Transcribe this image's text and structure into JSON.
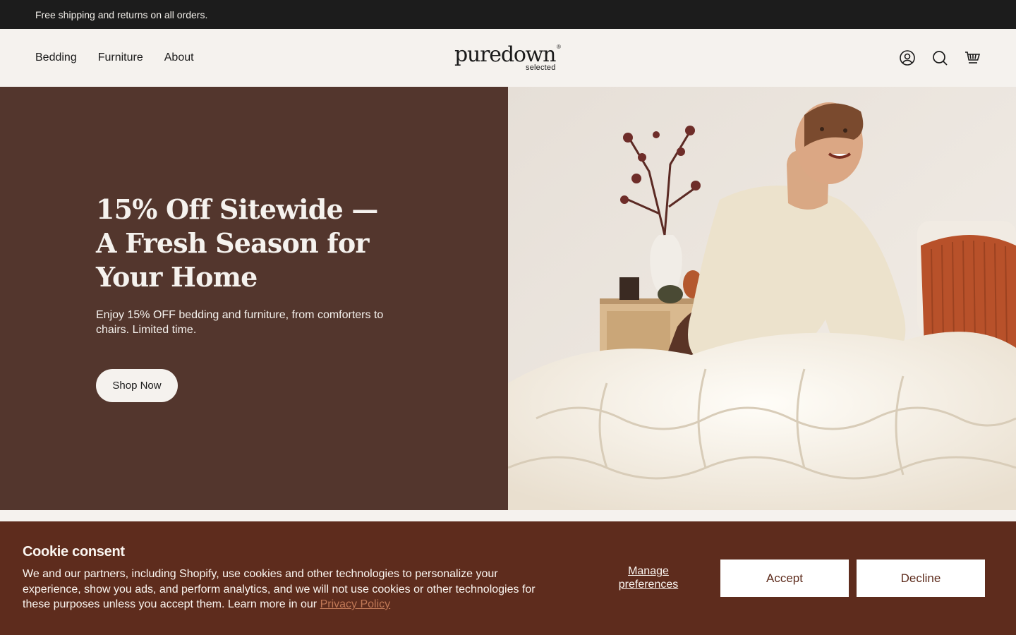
{
  "announcement": {
    "text": "Free shipping and returns on all orders."
  },
  "header": {
    "nav": [
      {
        "label": "Bedding"
      },
      {
        "label": "Furniture"
      },
      {
        "label": "About"
      }
    ],
    "logo": {
      "wordmark": "puredown",
      "registered": "®",
      "sub": "selected"
    },
    "icons": [
      "account-icon",
      "search-icon",
      "cart-icon"
    ]
  },
  "hero": {
    "title": "15% Off Sitewide — A Fresh Season for Your Home",
    "subtitle": "Enjoy 15% OFF bedding and furniture, from comforters to chairs. Limited time.",
    "cta": "Shop Now",
    "bg_color": "#53362d"
  },
  "cookie": {
    "title": "Cookie consent",
    "text": "We and our partners, including Shopify, use cookies and other technologies to personalize your experience, show you ads, and perform analytics, and we will not use cookies or other technologies for these purposes unless you accept them. Learn more in our ",
    "link": "Privacy Policy",
    "manage": "Manage preferences",
    "accept": "Accept",
    "decline": "Decline",
    "bg_color": "#5e2c1d"
  }
}
